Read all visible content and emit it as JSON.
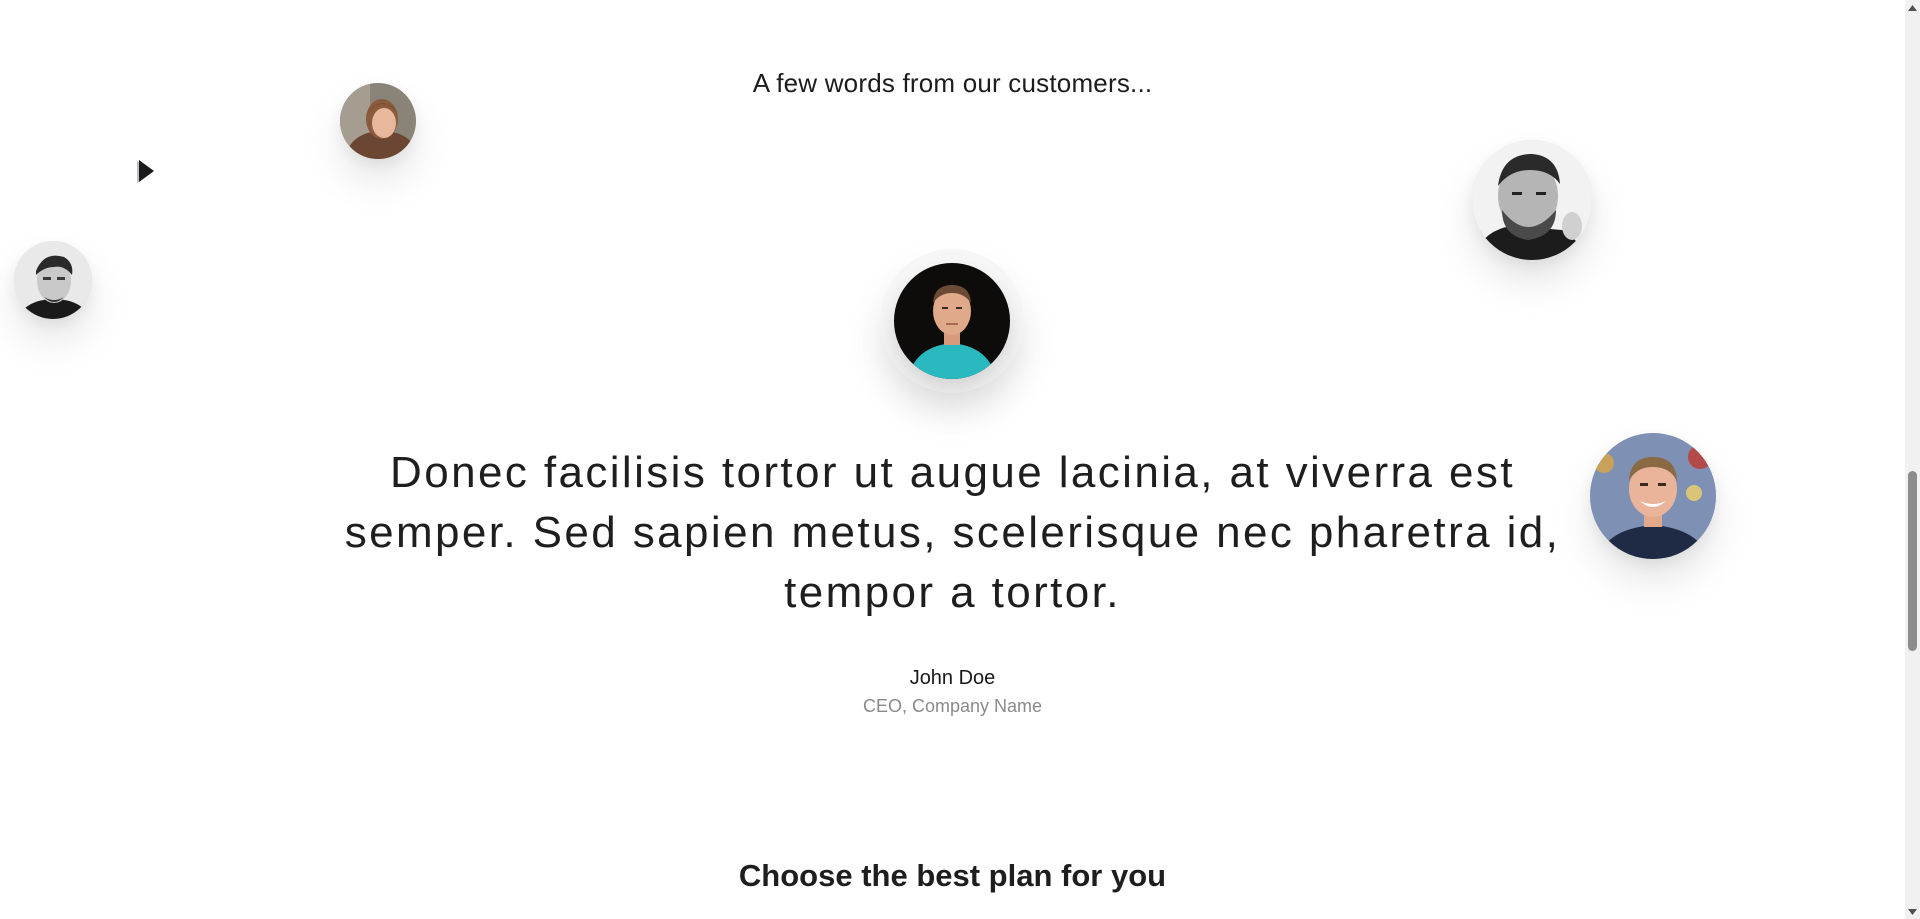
{
  "testimonials": {
    "heading": "A few words from our customers...",
    "quote": "Donec facilisis tortor ut augue lacinia, at viverra est semper. Sed sapien metus, scelerisque nec pharetra id, tempor a tortor.",
    "author_name": "John Doe",
    "author_role": "CEO, Company Name"
  },
  "pricing": {
    "heading": "Choose the best plan for you"
  },
  "colors": {
    "background": "#ffffff",
    "text": "#1e1e1e",
    "muted": "#8a8a8a",
    "scrollbar_thumb": "#8c8c8c"
  }
}
